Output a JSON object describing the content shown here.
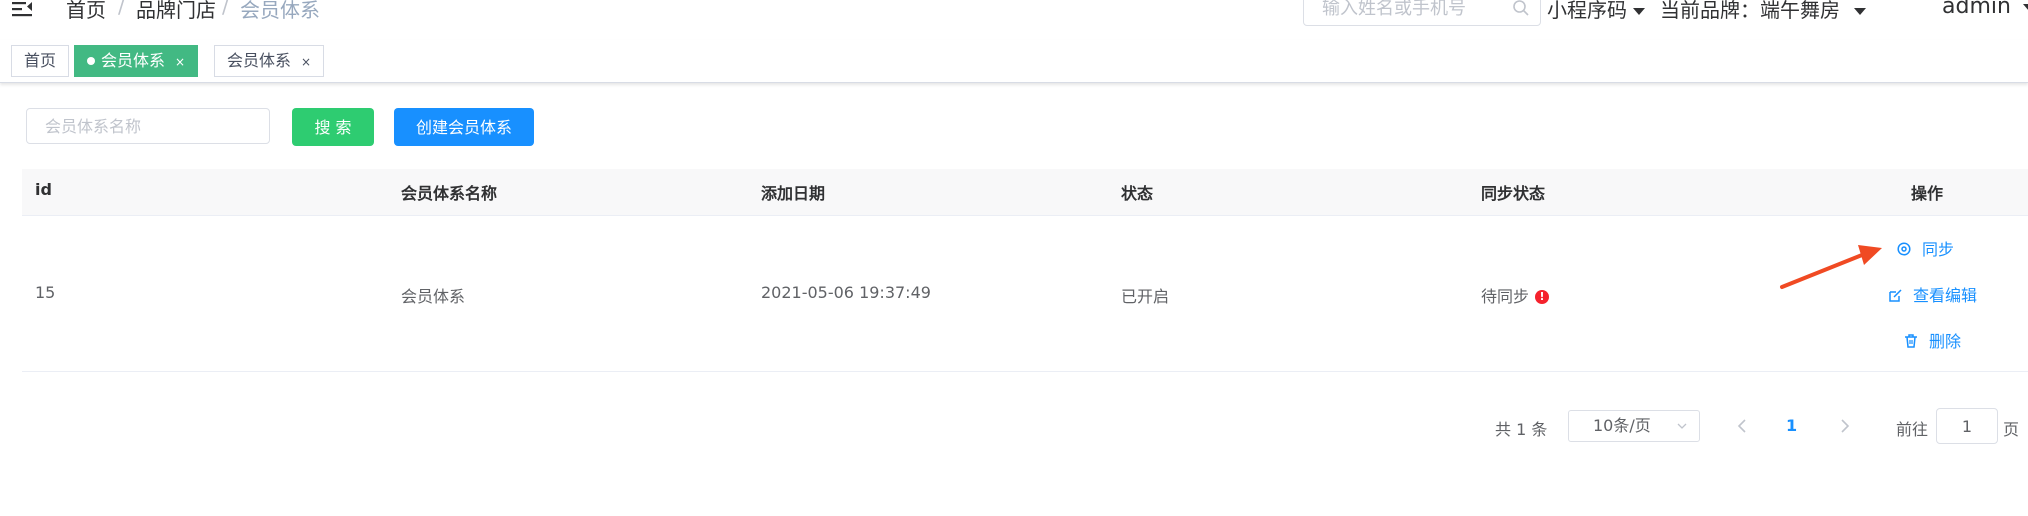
{
  "header": {
    "breadcrumb": [
      "首页",
      "品牌门店",
      "会员体系"
    ],
    "search_placeholder": "输入姓名或手机号",
    "mini_program_label": "小程序码",
    "brand_label": "当前品牌：端午舞房",
    "user_label": "admin"
  },
  "tags": [
    {
      "label": "首页"
    },
    {
      "label": "会员体系",
      "active": true
    },
    {
      "label": "会员体系"
    }
  ],
  "filter": {
    "name_placeholder": "会员体系名称",
    "search_label": "搜 索",
    "create_label": "创建会员体系"
  },
  "table": {
    "columns": [
      "id",
      "会员体系名称",
      "添加日期",
      "状态",
      "同步状态",
      "操作"
    ],
    "rows": [
      {
        "id": "15",
        "name": "会员体系",
        "date": "2021-05-06 19:37:49",
        "status": "已开启",
        "sync_status": "待同步",
        "sync_badge": "!",
        "actions": [
          "同步",
          "查看编辑",
          "删除"
        ]
      }
    ]
  },
  "pagination": {
    "total_text": "共 1 条",
    "page_size": "10条/页",
    "current_page": "1",
    "goto_prefix": "前往",
    "goto_value": "1",
    "goto_suffix": "页"
  },
  "colors": {
    "primary": "#1890ff",
    "success": "#2ecc71",
    "tag_active": "#42b983",
    "danger": "#f5222d",
    "annotation_arrow": "#f04a23"
  }
}
